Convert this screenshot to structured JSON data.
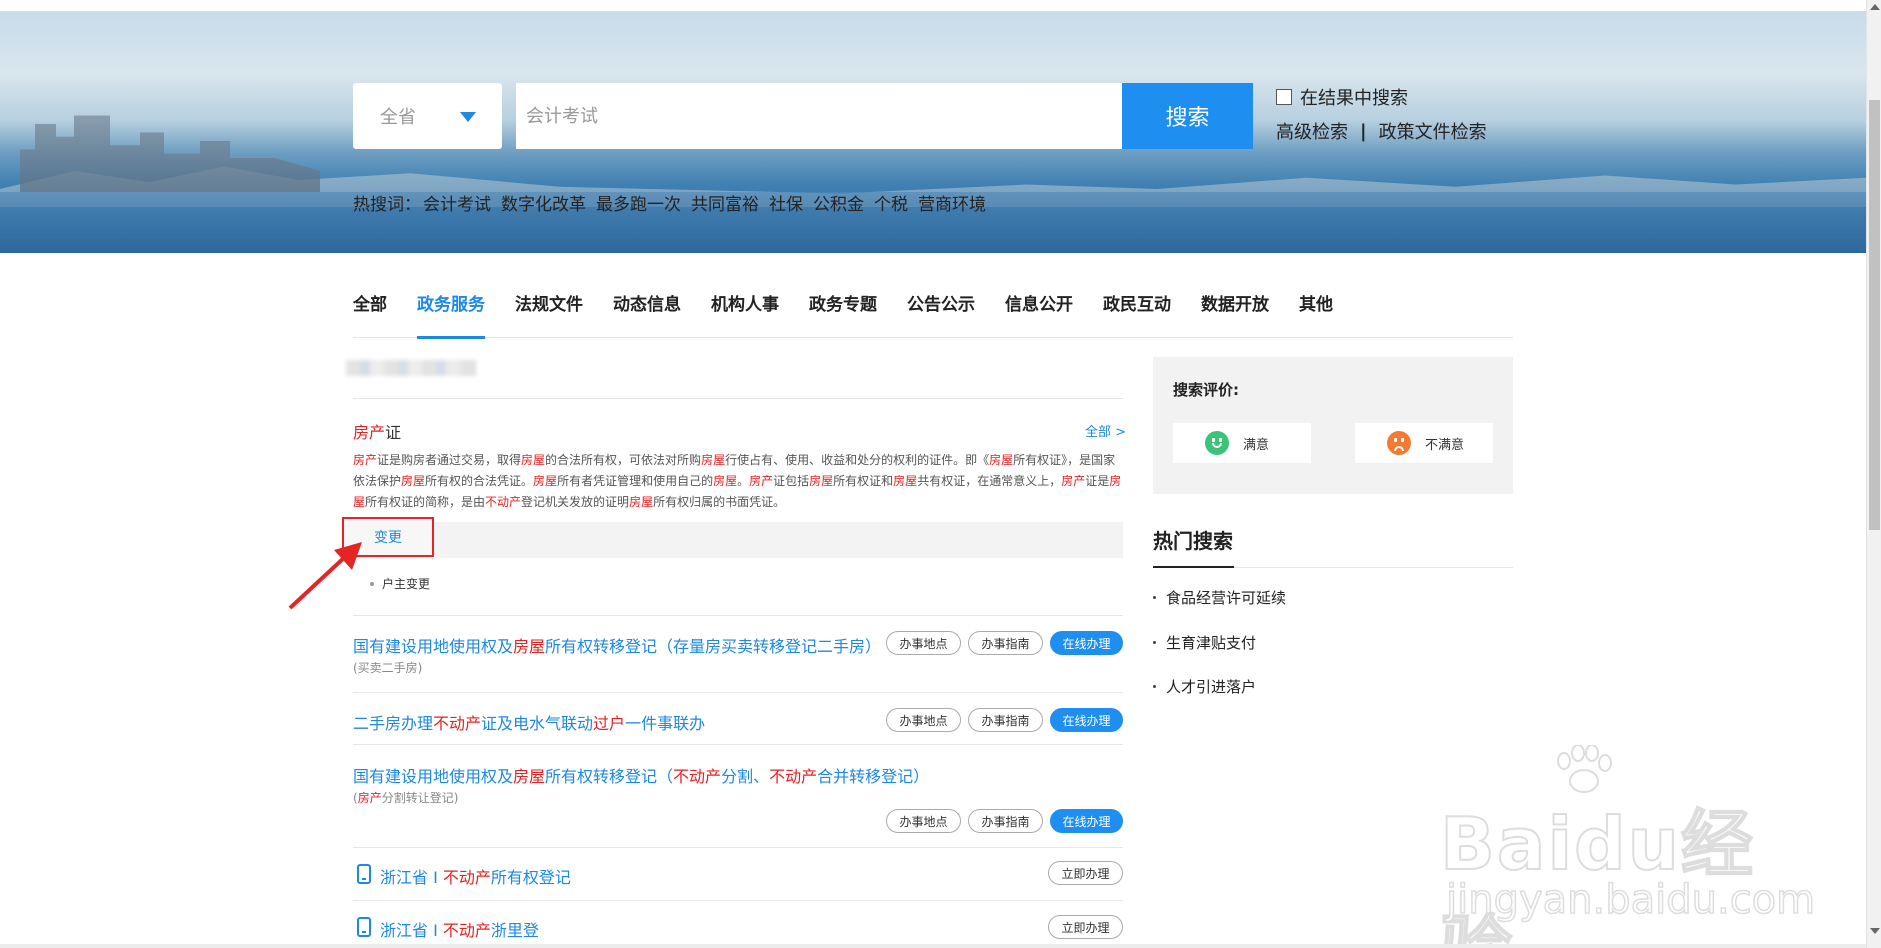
{
  "search": {
    "region": "全省",
    "placeholder": "会计考试",
    "button": "搜索",
    "in_result": "在结果中搜索",
    "advanced": "高级检索",
    "separator": "|",
    "policy": "政策文件检索"
  },
  "hot_words": {
    "label": "热搜词：",
    "items": [
      "会计考试",
      "数字化改革",
      "最多跑一次",
      "共同富裕",
      "社保",
      "公积金",
      "个税",
      "营商环境"
    ]
  },
  "tabs": [
    "全部",
    "政务服务",
    "法规文件",
    "动态信息",
    "机构人事",
    "政务专题",
    "公告公示",
    "信息公开",
    "政民互动",
    "数据开放",
    "其他"
  ],
  "active_tab": "政务服务",
  "card": {
    "title_red": "房产",
    "title_rest": "证",
    "all_link": "全部 >",
    "desc": [
      {
        "t": "房产",
        "r": true
      },
      {
        "t": "证是购房者通过交易，取得",
        "r": false
      },
      {
        "t": "房屋",
        "r": true
      },
      {
        "t": "的合法所有权，可依法对所购",
        "r": false
      },
      {
        "t": "房屋",
        "r": true
      },
      {
        "t": "行使占有、使用、收益和处分的权利的证件。即《",
        "r": false
      },
      {
        "t": "房屋",
        "r": true
      },
      {
        "t": "所有权证》，是国家依法保护",
        "r": false
      },
      {
        "t": "房屋",
        "r": true
      },
      {
        "t": "所有权的合法凭证。",
        "r": false
      },
      {
        "t": "房屋",
        "r": true
      },
      {
        "t": "所有者凭证管理和使用自己的",
        "r": false
      },
      {
        "t": "房屋",
        "r": true
      },
      {
        "t": "。",
        "r": false
      },
      {
        "t": "房产",
        "r": true
      },
      {
        "t": "证包括",
        "r": false
      },
      {
        "t": "房屋",
        "r": true
      },
      {
        "t": "所有权证和",
        "r": false
      },
      {
        "t": "房屋",
        "r": true
      },
      {
        "t": "共有权证，在通常意义上，",
        "r": false
      },
      {
        "t": "房产",
        "r": true
      },
      {
        "t": "证是",
        "r": false
      },
      {
        "t": "房屋",
        "r": true
      },
      {
        "t": "所有权证的简称，是由",
        "r": false
      },
      {
        "t": "不动产",
        "r": true
      },
      {
        "t": "登记机关发放的证明",
        "r": false
      },
      {
        "t": "房屋",
        "r": true
      },
      {
        "t": "所有权归属的书面凭证。",
        "r": false
      }
    ],
    "change_tab": "变更",
    "sub_item": "户主变更"
  },
  "services": [
    {
      "title": [
        {
          "t": "国有建设用地使用权及",
          "r": false
        },
        {
          "t": "房屋",
          "r": true
        },
        {
          "t": "所有权转移登记（存量房买卖转移登记二手房）",
          "r": false
        }
      ],
      "sub": [
        {
          "t": "(买卖二手房)",
          "r": false
        }
      ]
    },
    {
      "title": [
        {
          "t": "二手房办理",
          "r": false
        },
        {
          "t": "不动产",
          "r": true
        },
        {
          "t": "证及电水气联动",
          "r": false
        },
        {
          "t": "过户",
          "r": true
        },
        {
          "t": "一件事联办",
          "r": false
        }
      ],
      "sub": []
    },
    {
      "title": [
        {
          "t": "国有建设用地使用权及",
          "r": false
        },
        {
          "t": "房屋",
          "r": true
        },
        {
          "t": "所有权转移登记（",
          "r": false
        },
        {
          "t": "不动产",
          "r": true
        },
        {
          "t": "分割、",
          "r": false
        },
        {
          "t": "不动产",
          "r": true
        },
        {
          "t": "合并转移登记）",
          "r": false
        }
      ],
      "sub": [
        {
          "t": "(",
          "r": false
        },
        {
          "t": "房产",
          "r": true
        },
        {
          "t": "分割转让登记)",
          "r": false
        }
      ]
    }
  ],
  "service_buttons": {
    "location": "办事地点",
    "guide": "办事指南",
    "online": "在线办理"
  },
  "zj_items": [
    {
      "title": [
        {
          "t": "浙江省 I ",
          "r": false
        },
        {
          "t": "不动产",
          "r": true
        },
        {
          "t": "所有权登记",
          "r": false
        }
      ],
      "button": "立即办理"
    },
    {
      "title": [
        {
          "t": "浙江省 I ",
          "r": false
        },
        {
          "t": "不动产",
          "r": true
        },
        {
          "t": "浙里登",
          "r": false
        }
      ],
      "button": "立即办理"
    }
  ],
  "rating": {
    "title": "搜索评价:",
    "satisfied": "满意",
    "unsatisfied": "不满意"
  },
  "hot_search": {
    "title": "热门搜索",
    "items": [
      "食品经营许可延续",
      "生育津贴支付",
      "人才引进落户"
    ]
  },
  "watermark": {
    "brand": "Baidu经验",
    "url": "jingyan.baidu.com"
  }
}
